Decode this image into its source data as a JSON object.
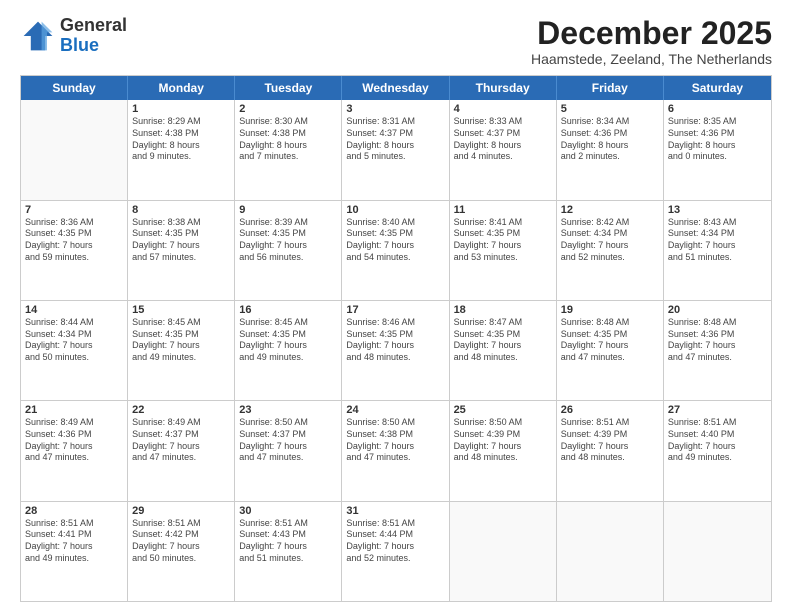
{
  "logo": {
    "general": "General",
    "blue": "Blue"
  },
  "header": {
    "month": "December 2025",
    "location": "Haamstede, Zeeland, The Netherlands"
  },
  "weekdays": [
    "Sunday",
    "Monday",
    "Tuesday",
    "Wednesday",
    "Thursday",
    "Friday",
    "Saturday"
  ],
  "rows": [
    [
      {
        "day": "",
        "info": ""
      },
      {
        "day": "1",
        "info": "Sunrise: 8:29 AM\nSunset: 4:38 PM\nDaylight: 8 hours\nand 9 minutes."
      },
      {
        "day": "2",
        "info": "Sunrise: 8:30 AM\nSunset: 4:38 PM\nDaylight: 8 hours\nand 7 minutes."
      },
      {
        "day": "3",
        "info": "Sunrise: 8:31 AM\nSunset: 4:37 PM\nDaylight: 8 hours\nand 5 minutes."
      },
      {
        "day": "4",
        "info": "Sunrise: 8:33 AM\nSunset: 4:37 PM\nDaylight: 8 hours\nand 4 minutes."
      },
      {
        "day": "5",
        "info": "Sunrise: 8:34 AM\nSunset: 4:36 PM\nDaylight: 8 hours\nand 2 minutes."
      },
      {
        "day": "6",
        "info": "Sunrise: 8:35 AM\nSunset: 4:36 PM\nDaylight: 8 hours\nand 0 minutes."
      }
    ],
    [
      {
        "day": "7",
        "info": "Sunrise: 8:36 AM\nSunset: 4:35 PM\nDaylight: 7 hours\nand 59 minutes."
      },
      {
        "day": "8",
        "info": "Sunrise: 8:38 AM\nSunset: 4:35 PM\nDaylight: 7 hours\nand 57 minutes."
      },
      {
        "day": "9",
        "info": "Sunrise: 8:39 AM\nSunset: 4:35 PM\nDaylight: 7 hours\nand 56 minutes."
      },
      {
        "day": "10",
        "info": "Sunrise: 8:40 AM\nSunset: 4:35 PM\nDaylight: 7 hours\nand 54 minutes."
      },
      {
        "day": "11",
        "info": "Sunrise: 8:41 AM\nSunset: 4:35 PM\nDaylight: 7 hours\nand 53 minutes."
      },
      {
        "day": "12",
        "info": "Sunrise: 8:42 AM\nSunset: 4:34 PM\nDaylight: 7 hours\nand 52 minutes."
      },
      {
        "day": "13",
        "info": "Sunrise: 8:43 AM\nSunset: 4:34 PM\nDaylight: 7 hours\nand 51 minutes."
      }
    ],
    [
      {
        "day": "14",
        "info": "Sunrise: 8:44 AM\nSunset: 4:34 PM\nDaylight: 7 hours\nand 50 minutes."
      },
      {
        "day": "15",
        "info": "Sunrise: 8:45 AM\nSunset: 4:35 PM\nDaylight: 7 hours\nand 49 minutes."
      },
      {
        "day": "16",
        "info": "Sunrise: 8:45 AM\nSunset: 4:35 PM\nDaylight: 7 hours\nand 49 minutes."
      },
      {
        "day": "17",
        "info": "Sunrise: 8:46 AM\nSunset: 4:35 PM\nDaylight: 7 hours\nand 48 minutes."
      },
      {
        "day": "18",
        "info": "Sunrise: 8:47 AM\nSunset: 4:35 PM\nDaylight: 7 hours\nand 48 minutes."
      },
      {
        "day": "19",
        "info": "Sunrise: 8:48 AM\nSunset: 4:35 PM\nDaylight: 7 hours\nand 47 minutes."
      },
      {
        "day": "20",
        "info": "Sunrise: 8:48 AM\nSunset: 4:36 PM\nDaylight: 7 hours\nand 47 minutes."
      }
    ],
    [
      {
        "day": "21",
        "info": "Sunrise: 8:49 AM\nSunset: 4:36 PM\nDaylight: 7 hours\nand 47 minutes."
      },
      {
        "day": "22",
        "info": "Sunrise: 8:49 AM\nSunset: 4:37 PM\nDaylight: 7 hours\nand 47 minutes."
      },
      {
        "day": "23",
        "info": "Sunrise: 8:50 AM\nSunset: 4:37 PM\nDaylight: 7 hours\nand 47 minutes."
      },
      {
        "day": "24",
        "info": "Sunrise: 8:50 AM\nSunset: 4:38 PM\nDaylight: 7 hours\nand 47 minutes."
      },
      {
        "day": "25",
        "info": "Sunrise: 8:50 AM\nSunset: 4:39 PM\nDaylight: 7 hours\nand 48 minutes."
      },
      {
        "day": "26",
        "info": "Sunrise: 8:51 AM\nSunset: 4:39 PM\nDaylight: 7 hours\nand 48 minutes."
      },
      {
        "day": "27",
        "info": "Sunrise: 8:51 AM\nSunset: 4:40 PM\nDaylight: 7 hours\nand 49 minutes."
      }
    ],
    [
      {
        "day": "28",
        "info": "Sunrise: 8:51 AM\nSunset: 4:41 PM\nDaylight: 7 hours\nand 49 minutes."
      },
      {
        "day": "29",
        "info": "Sunrise: 8:51 AM\nSunset: 4:42 PM\nDaylight: 7 hours\nand 50 minutes."
      },
      {
        "day": "30",
        "info": "Sunrise: 8:51 AM\nSunset: 4:43 PM\nDaylight: 7 hours\nand 51 minutes."
      },
      {
        "day": "31",
        "info": "Sunrise: 8:51 AM\nSunset: 4:44 PM\nDaylight: 7 hours\nand 52 minutes."
      },
      {
        "day": "",
        "info": ""
      },
      {
        "day": "",
        "info": ""
      },
      {
        "day": "",
        "info": ""
      }
    ]
  ]
}
